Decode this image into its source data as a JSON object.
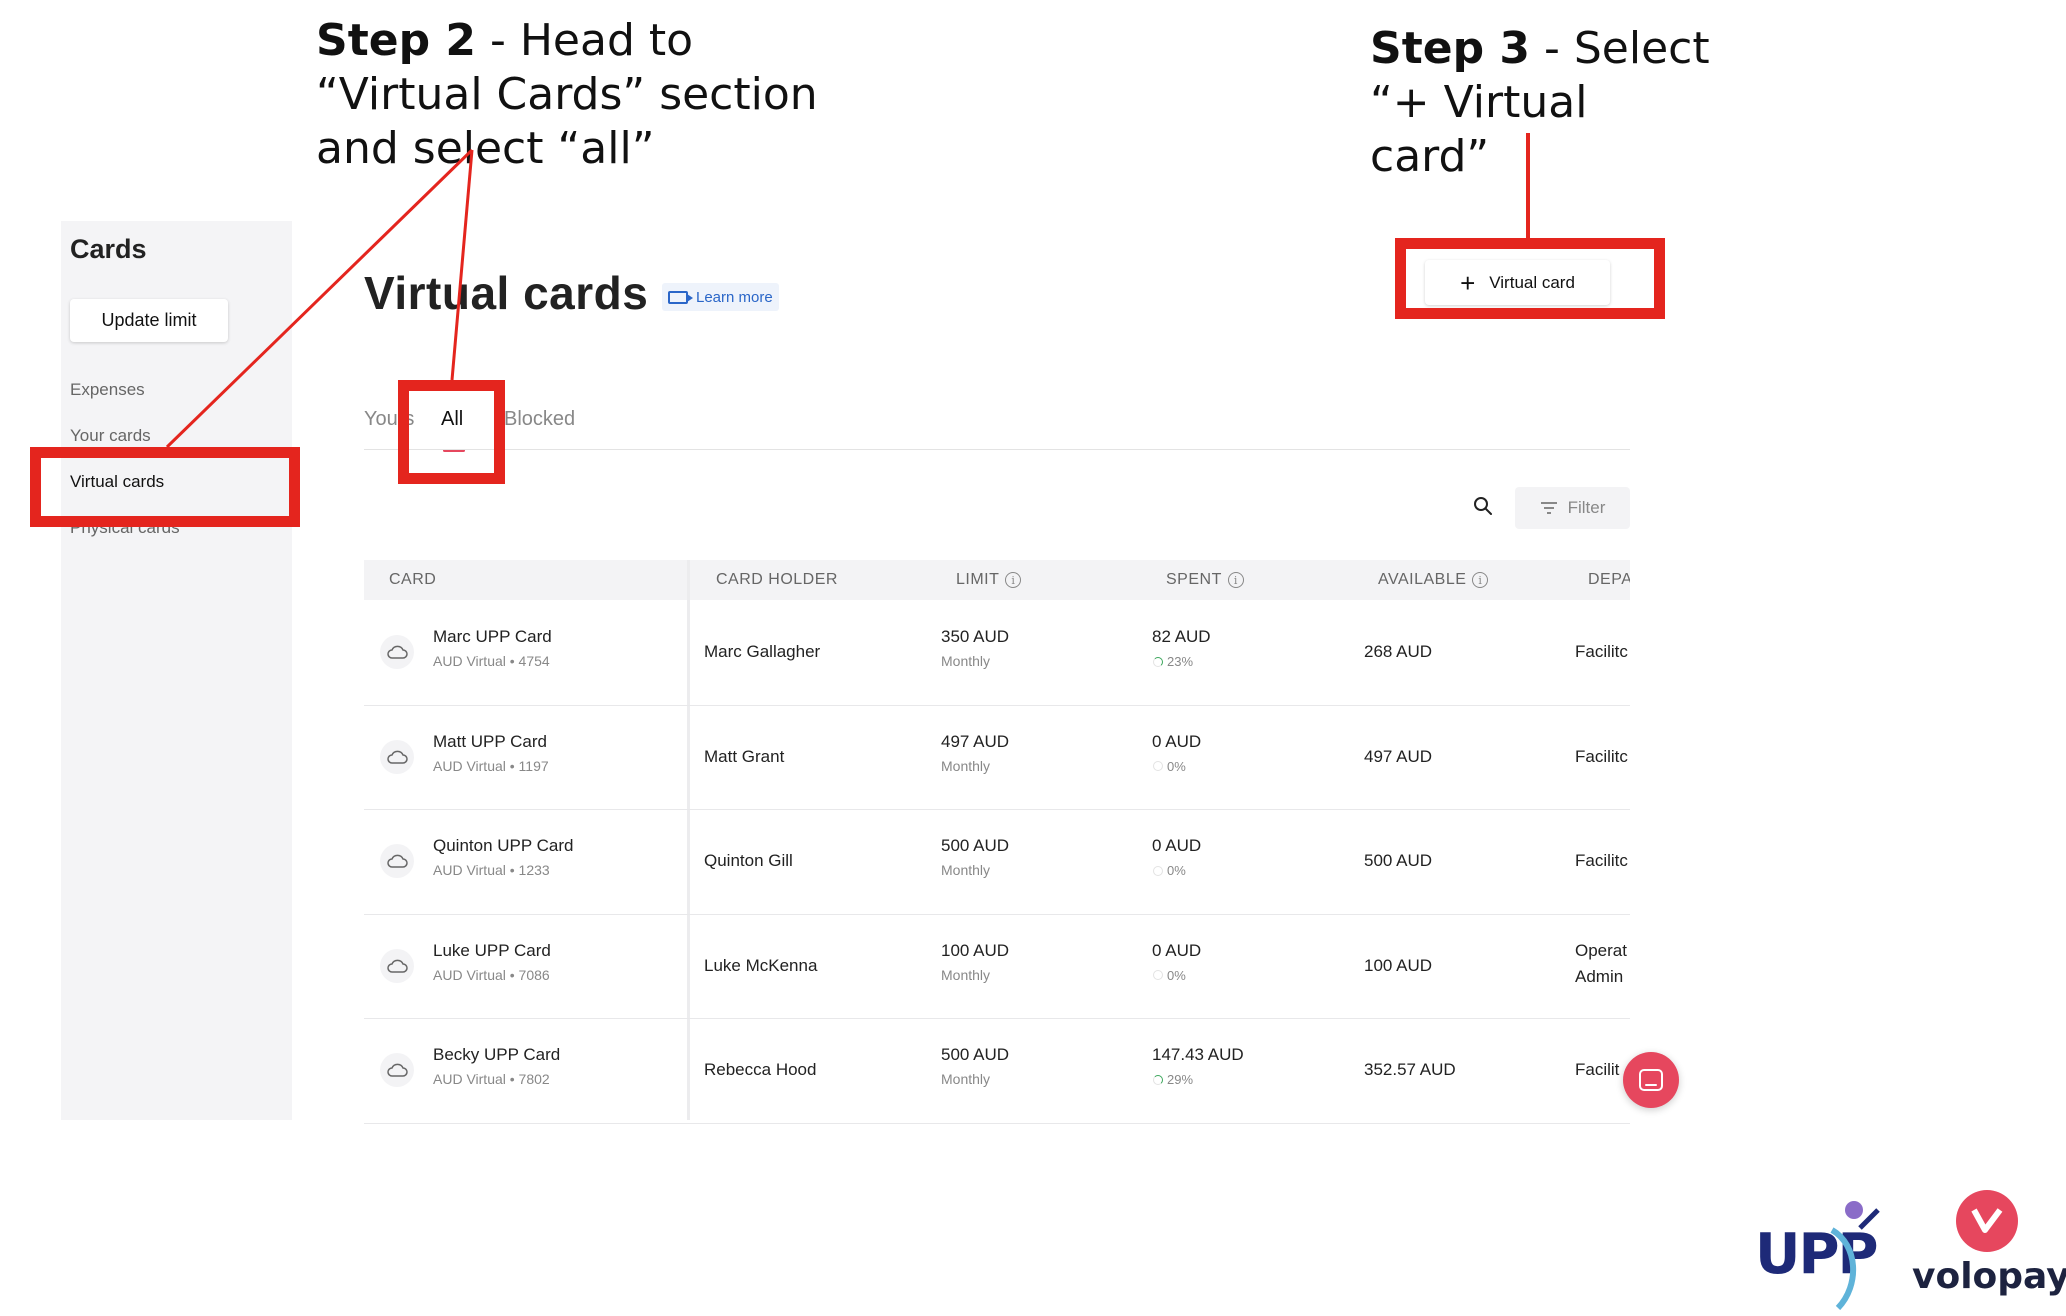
{
  "annotations": {
    "step2_bold": "Step 2",
    "step2_text": " - Head to “Virtual Cards” section and select “all”",
    "step3_bold": "Step 3",
    "step3_text": " - Select “+ Virtual card”",
    "highlight_color": "#e4251e"
  },
  "sidebar": {
    "title": "Cards",
    "update_limit_label": "Update limit",
    "items": [
      {
        "label": "Expenses"
      },
      {
        "label": "Your cards"
      },
      {
        "label": "Virtual cards",
        "active": true
      },
      {
        "label": "Physical cards"
      }
    ]
  },
  "header": {
    "title": "Virtual cards",
    "learn_more": "Learn more",
    "new_card_label": "Virtual card"
  },
  "tabs": [
    {
      "label": "Yours"
    },
    {
      "label": "All",
      "active": true
    },
    {
      "label": "Blocked"
    }
  ],
  "toolbar": {
    "filter_label": "Filter"
  },
  "table": {
    "columns": [
      "CARD",
      "CARD HOLDER",
      "LIMIT",
      "SPENT",
      "AVAILABLE",
      "DEPARTMENT"
    ],
    "rows": [
      {
        "card": "Marc UPP Card",
        "card_sub": "AUD Virtual • 4754",
        "holder": "Marc Gallagher",
        "limit": "350 AUD",
        "limit_sub": "Monthly",
        "spent": "82 AUD",
        "spent_pct": "23%",
        "available": "268 AUD",
        "dept": "Facilitc",
        "dept2": ""
      },
      {
        "card": "Matt UPP Card",
        "card_sub": "AUD Virtual • 1197",
        "holder": "Matt Grant",
        "limit": "497 AUD",
        "limit_sub": "Monthly",
        "spent": "0 AUD",
        "spent_pct": "0%",
        "available": "497 AUD",
        "dept": "Facilitc",
        "dept2": ""
      },
      {
        "card": "Quinton UPP Card",
        "card_sub": "AUD Virtual • 1233",
        "holder": "Quinton Gill",
        "limit": "500 AUD",
        "limit_sub": "Monthly",
        "spent": "0 AUD",
        "spent_pct": "0%",
        "available": "500 AUD",
        "dept": "Facilitc",
        "dept2": ""
      },
      {
        "card": "Luke UPP Card",
        "card_sub": "AUD Virtual • 7086",
        "holder": "Luke McKenna",
        "limit": "100 AUD",
        "limit_sub": "Monthly",
        "spent": "0 AUD",
        "spent_pct": "0%",
        "available": "100 AUD",
        "dept": "Operat",
        "dept2": "Admin"
      },
      {
        "card": "Becky UPP Card",
        "card_sub": "AUD Virtual • 7802",
        "holder": "Rebecca Hood",
        "limit": "500 AUD",
        "limit_sub": "Monthly",
        "spent": "147.43 AUD",
        "spent_pct": "29%",
        "available": "352.57 AUD",
        "dept": "Facilit",
        "dept2": ""
      }
    ]
  },
  "logos": {
    "upp": "UPP",
    "volopay": "volopay"
  }
}
